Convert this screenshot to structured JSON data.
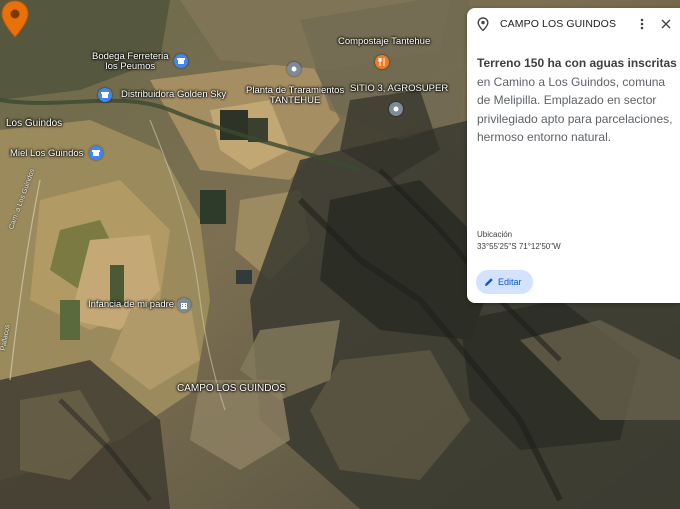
{
  "map": {
    "pois": [
      {
        "name": "Bodega Ferreteria los Peumos",
        "line1": "Bodega Ferreteria",
        "line2": "los Peumos",
        "icon": "shop-icon",
        "color": "#4285f4"
      },
      {
        "name": "Distribuidora Golden Sky",
        "icon": "shop-icon",
        "color": "#4285f4"
      },
      {
        "name": "Planta de Traramientos TANTEHUE",
        "line1": "Planta de Traramientos",
        "line2": "TANTEHUE",
        "icon": "place-icon",
        "color": "#7d8a99"
      },
      {
        "name": "Compostaje Tantehue",
        "icon": "food-icon",
        "color": "#f27b22"
      },
      {
        "name": "SITIO 3, AGROSUPER",
        "icon": "place-icon",
        "color": "#7d8a99"
      },
      {
        "name": "Miel Los Guindos",
        "icon": "shop-icon",
        "color": "#4285f4"
      },
      {
        "name": "Infancia de mi padre",
        "icon": "building-icon",
        "color": "#7d8a99"
      }
    ],
    "town_label": "Los Guindos",
    "roads": [
      "Cam. a Los Guindos",
      "Pallacos"
    ],
    "selected_place_label": "CAMPO LOS GUINDOS",
    "pin_color": "#e8710a"
  },
  "panel": {
    "title": "CAMPO LOS GUINDOS",
    "description_bold": "Terreno 150 ha con aguas inscritas",
    "description_rest": " en Camino a Los Guindos, comuna de Melipilla. Emplazado en sector privilegiado apto para parcelaciones, hermoso entorno natural.",
    "location_label": "Ubicación",
    "coordinates": "33°55'25\"S 71°12'50\"W",
    "edit_label": "Editar"
  }
}
